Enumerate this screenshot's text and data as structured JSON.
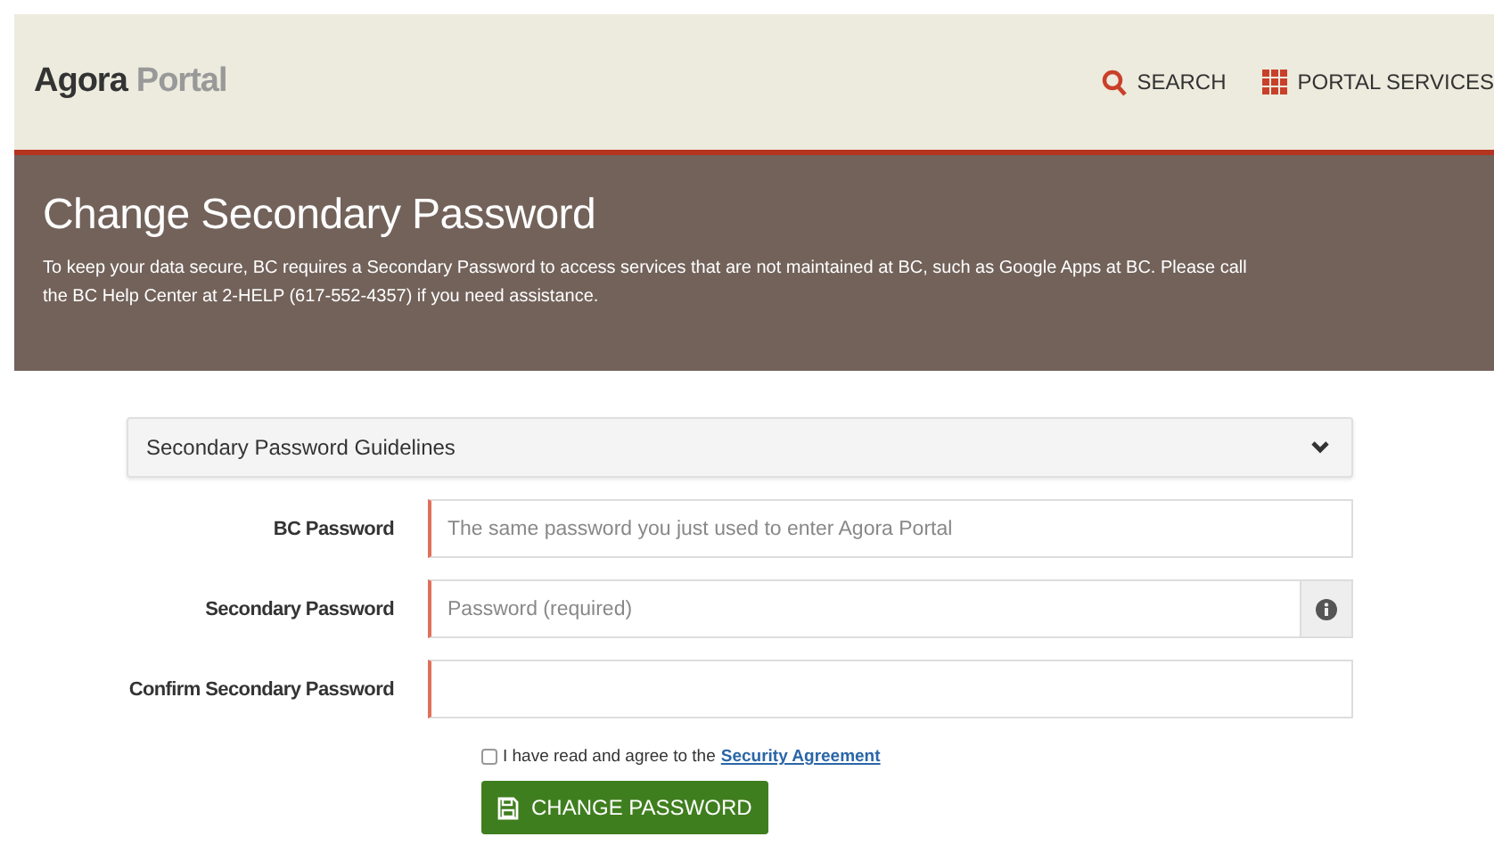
{
  "header": {
    "brand_main": "Agora",
    "brand_sub": "Portal",
    "nav": [
      {
        "kind": "search",
        "label": "SEARCH"
      },
      {
        "kind": "grid",
        "label": "PORTAL SERVICES"
      }
    ]
  },
  "banner": {
    "title": "Change Secondary Password",
    "text": "To keep your data secure, BC requires a Secondary Password to access services that are not maintained at BC, such as Google Apps at BC. Please call the BC Help Center at 2-HELP (617-552-4357) if you need assistance."
  },
  "guidelines": {
    "label": "Secondary Password Guidelines",
    "expanded": false
  },
  "fields": [
    {
      "label": "BC Password",
      "placeholder": "The same password you just used to enter Agora Portal",
      "info": false
    },
    {
      "label": "Secondary Password",
      "placeholder": "Password (required)",
      "info": true
    },
    {
      "label": "Confirm Secondary Password",
      "info": false
    }
  ],
  "agreement": {
    "text": "I have read and agree to the",
    "link": "Security Agreement",
    "checked": false
  },
  "submit": {
    "label": "CHANGE PASSWORD"
  }
}
